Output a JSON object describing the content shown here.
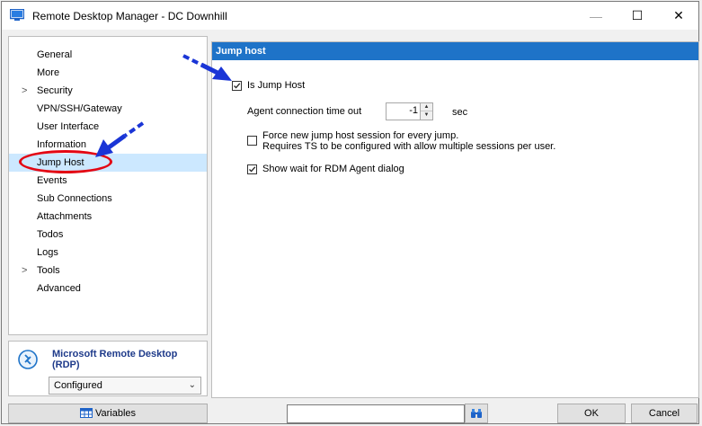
{
  "window": {
    "title": "Remote Desktop Manager - DC Downhill",
    "minimize_glyph": "—",
    "maximize_glyph": "☐",
    "close_glyph": "✕"
  },
  "sidebar": {
    "items": [
      {
        "label": "General",
        "has_children": false
      },
      {
        "label": "More",
        "has_children": false
      },
      {
        "label": "Security",
        "has_children": true
      },
      {
        "label": "VPN/SSH/Gateway",
        "has_children": false
      },
      {
        "label": "User Interface",
        "has_children": false
      },
      {
        "label": "Information",
        "has_children": false
      },
      {
        "label": "Jump Host",
        "has_children": false,
        "selected": true
      },
      {
        "label": "Events",
        "has_children": false
      },
      {
        "label": "Sub Connections",
        "has_children": false
      },
      {
        "label": "Attachments",
        "has_children": false
      },
      {
        "label": "Todos",
        "has_children": false
      },
      {
        "label": "Logs",
        "has_children": false
      },
      {
        "label": "Tools",
        "has_children": true
      },
      {
        "label": "Advanced",
        "has_children": false
      }
    ],
    "chevron_glyph": ">"
  },
  "entry_type": {
    "name": "Microsoft Remote Desktop (RDP)",
    "icon": "rdp-icon",
    "status": "Configured"
  },
  "content": {
    "header": "Jump host",
    "is_jump_host": {
      "label": "Is Jump Host",
      "checked": true
    },
    "timeout": {
      "label": "Agent connection time out",
      "value": "-1",
      "unit": "sec"
    },
    "force_new": {
      "line1": "Force new jump host session for every jump.",
      "line2": "Requires TS to be configured with allow multiple sessions per user.",
      "checked": false
    },
    "show_wait": {
      "label": "Show wait for RDM Agent dialog",
      "checked": true
    }
  },
  "footer": {
    "variables_label": "Variables",
    "search_value": "",
    "ok_label": "OK",
    "cancel_label": "Cancel"
  },
  "colors": {
    "header_bg": "#1e73c8",
    "selection_bg": "#cce8ff",
    "annotation_arrow": "#1a35d6",
    "annotation_ellipse": "#e30613",
    "rdp_name": "#1e3a8a"
  }
}
